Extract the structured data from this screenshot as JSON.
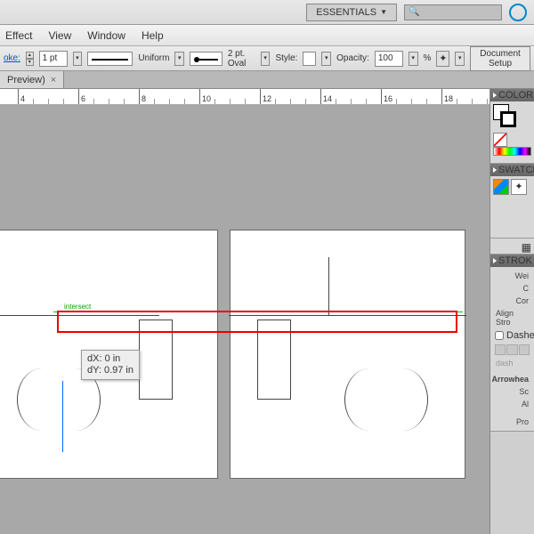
{
  "topbar": {
    "workspace": "ESSENTIALS"
  },
  "menu": {
    "effect": "Effect",
    "view": "View",
    "window": "Window",
    "help": "Help"
  },
  "control": {
    "stroke_lbl": "oke:",
    "weight": "1 pt",
    "profile": "Uniform",
    "brush": "2 pt. Oval",
    "style_lbl": "Style:",
    "opacity_lbl": "Opacity:",
    "opacity": "100",
    "pct": "%",
    "docsetup": "Document Setup"
  },
  "tab": {
    "name": "Preview)"
  },
  "ruler": {
    "marks": [
      "4",
      "6",
      "8",
      "10",
      "12",
      "14",
      "16",
      "18"
    ]
  },
  "smartguide": {
    "label": "intersect"
  },
  "tooltip": {
    "dx": "dX: 0 in",
    "dy": "dY: 0.97 in"
  },
  "panels": {
    "color": "COLOR",
    "swatches": "SWATCH",
    "stroke": "STROK",
    "weight": "Wei",
    "cap": "C",
    "corner": "Cor",
    "alignstroke": "Align Stro",
    "dashed": "Dashe",
    "dash": "dash",
    "arrowheads": "Arrowhea",
    "scale": "Sc",
    "align": "Al",
    "profile": "Pro"
  }
}
